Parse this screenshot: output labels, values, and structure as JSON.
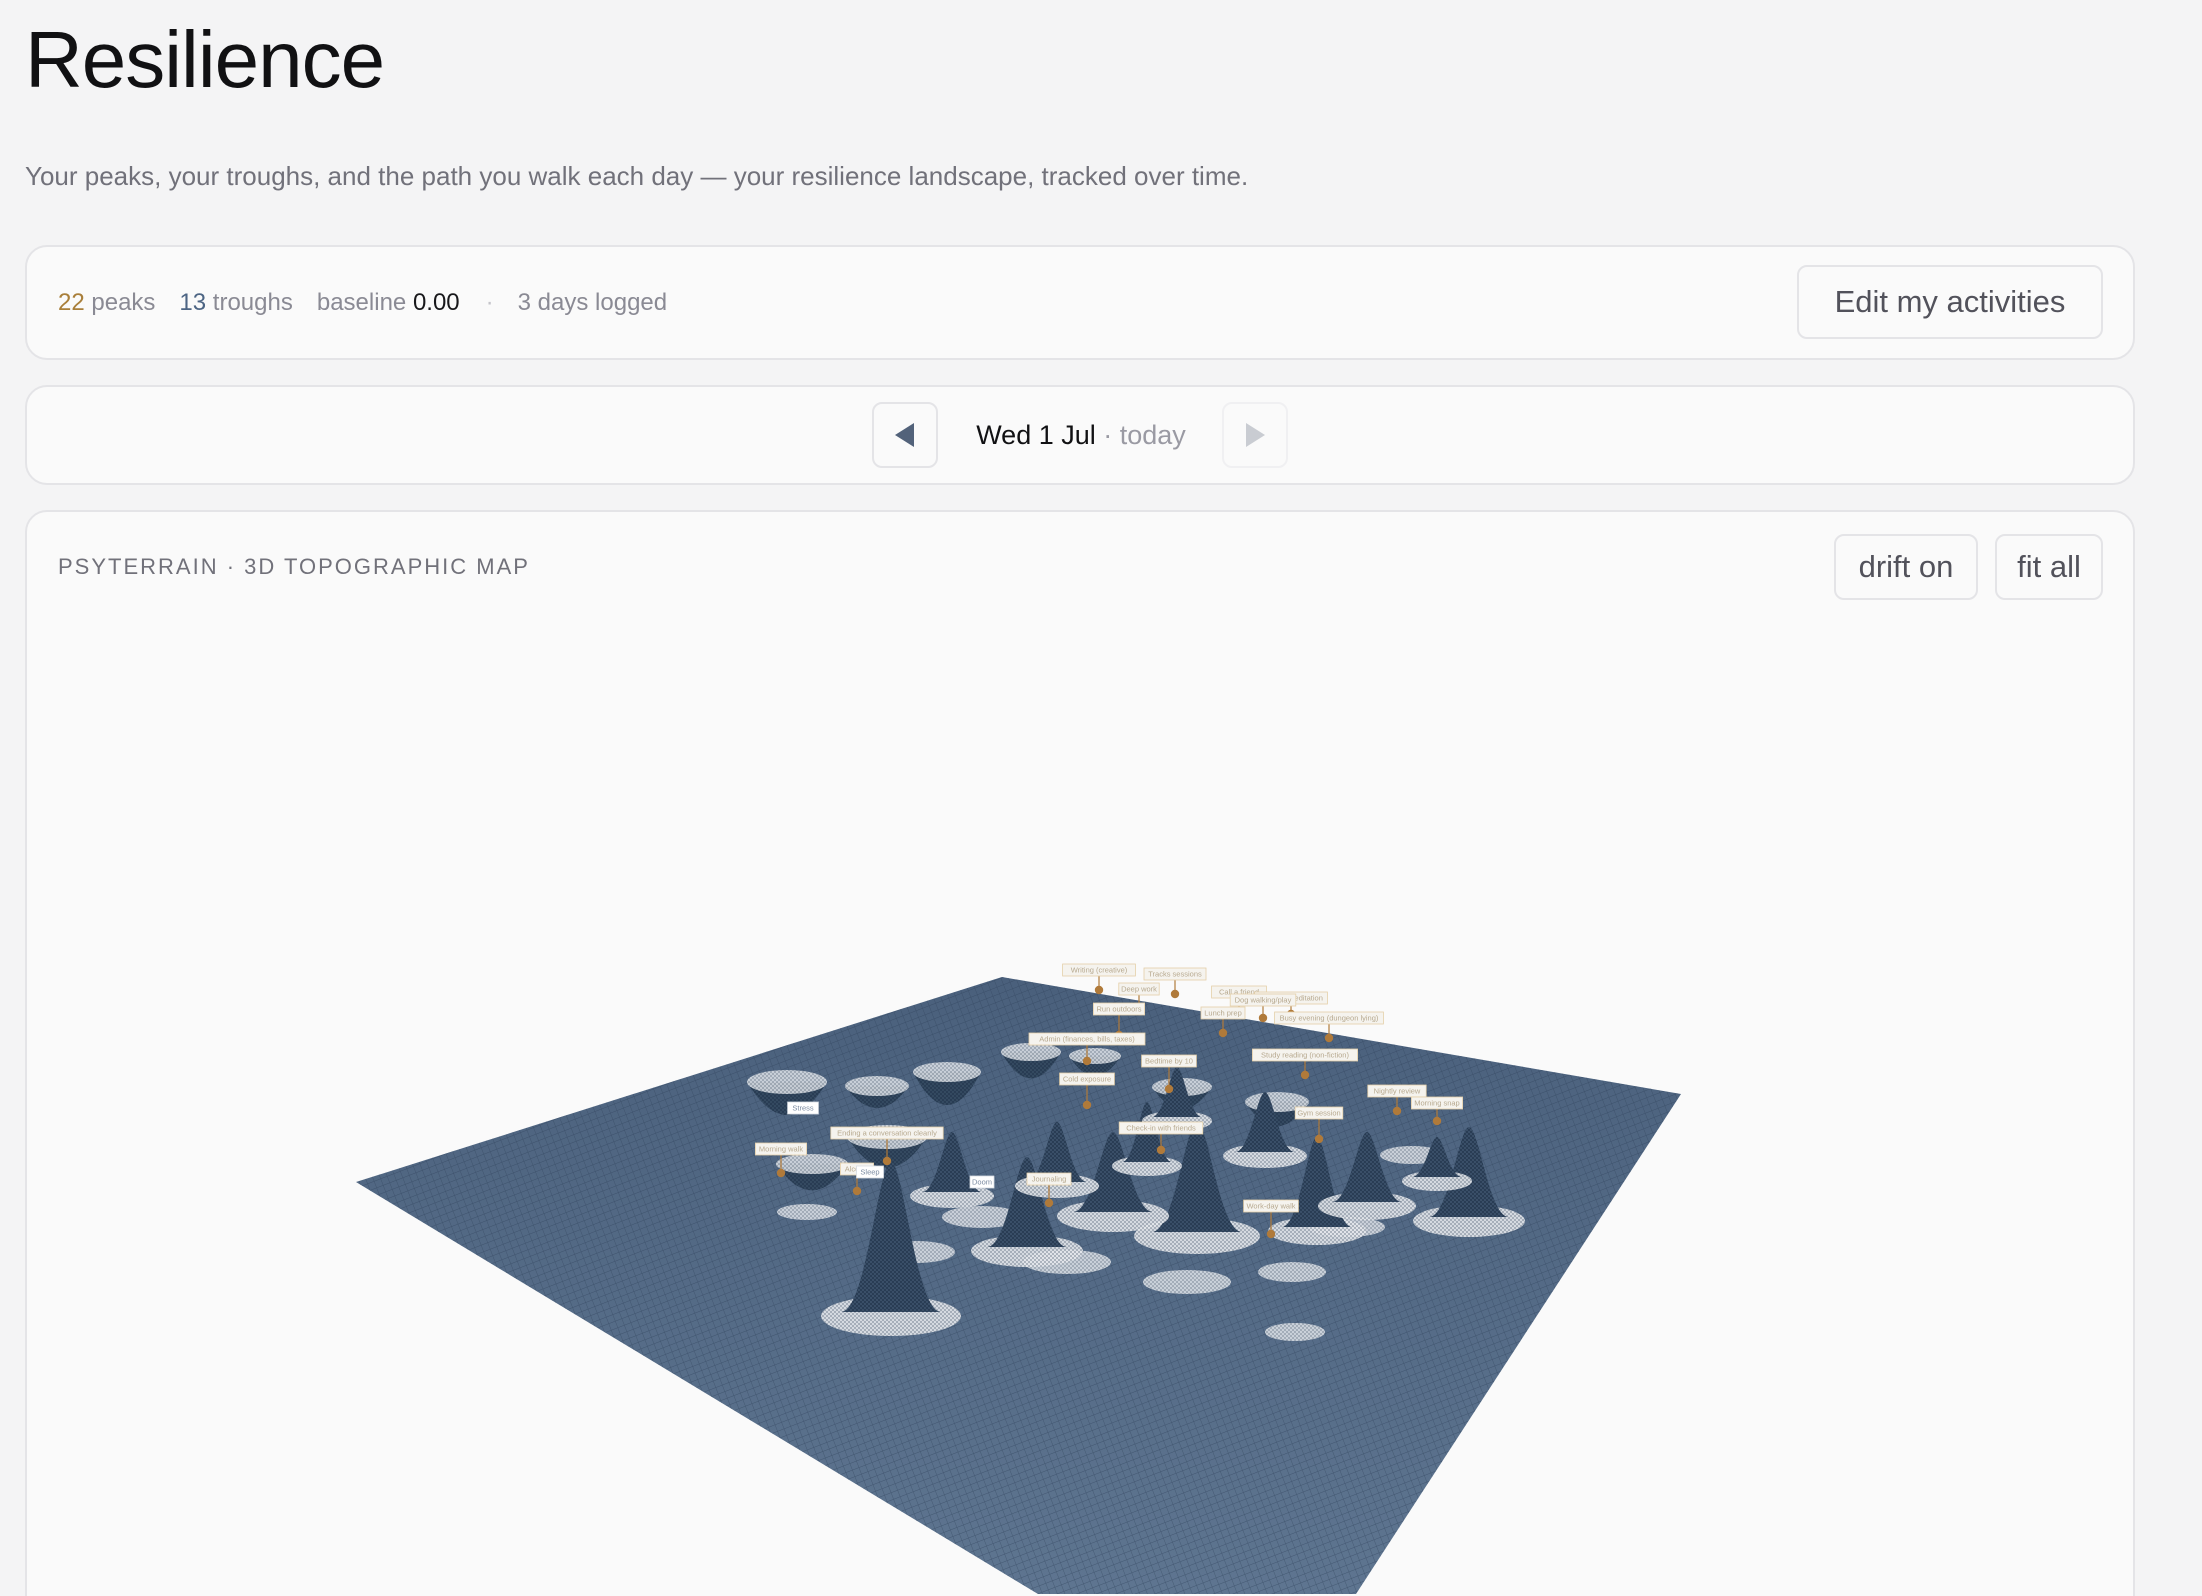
{
  "page": {
    "title": "Resilience",
    "subtitle": "Your peaks, your troughs, and the path you walk each day — your resilience landscape, tracked over time."
  },
  "stats": {
    "peaks_count": "22",
    "peaks_label": "peaks",
    "troughs_count": "13",
    "troughs_label": "troughs",
    "baseline_label": "baseline",
    "baseline_value": "0.00",
    "separator": "·",
    "days_logged": "3 days logged",
    "edit_button": "Edit my activities"
  },
  "date_nav": {
    "date": "Wed 1 Jul",
    "suffix": "· today",
    "prev_icon": "triangle-left-icon",
    "next_icon": "triangle-right-icon",
    "next_enabled": false
  },
  "map": {
    "heading": "PSYTERRAIN · 3D TOPOGRAPHIC MAP",
    "drift_button": "drift on",
    "fit_button": "fit all",
    "colors": {
      "surface": "#4f6580",
      "peak_marker": "#b07a3a",
      "label_bg": "#f5f3ee",
      "peak_label_border": "#e4cfa8",
      "trough_label_border": "#d7dce3"
    },
    "peak_labels": [
      "Writing (creative)",
      "Tracks sessions",
      "Deep work",
      "Call a friend",
      "Morning meditation",
      "Dog walking/play",
      "Run outdoors",
      "Lunch prep",
      "Busy evening (dungeon lying)",
      "Admin (finances, bills, taxes)",
      "Bedtime by 10",
      "Study reading (non-fiction)",
      "Cold exposure",
      "Nightly review",
      "Morning snap",
      "Ending a conversation cleanly",
      "Check-in with friends",
      "Gym session",
      "Morning walk",
      "Journaling",
      "Work-day walk",
      "Alcohol"
    ],
    "trough_labels": [
      "Stress",
      "Sleep",
      "Doom"
    ]
  }
}
